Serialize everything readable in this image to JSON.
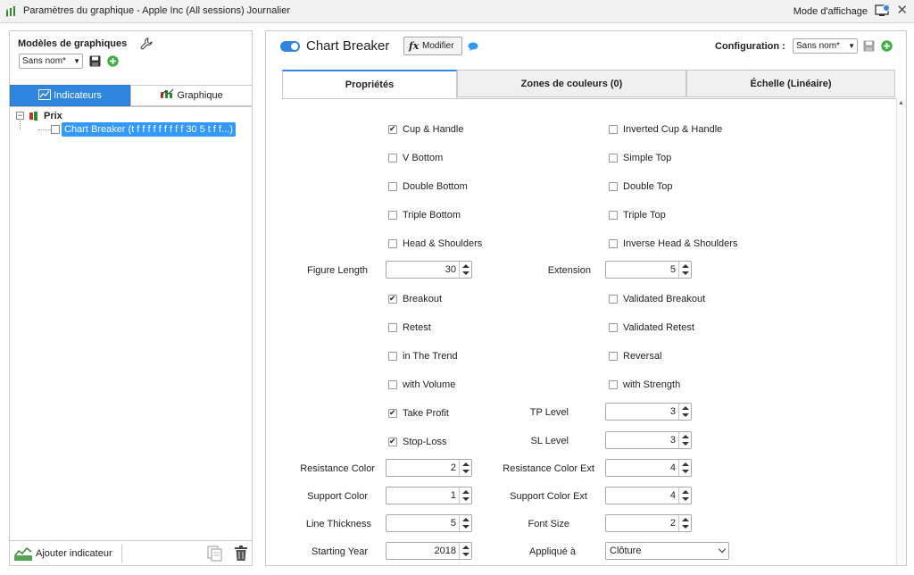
{
  "window": {
    "title": "Paramètres du graphique - Apple Inc (All sessions) Journalier",
    "mode_label": "Mode d'affichage"
  },
  "left": {
    "templates_title": "Modèles de graphiques",
    "template_value": "Sans nom*",
    "tabs": {
      "indicators": "Indicateurs",
      "chart": "Graphique"
    },
    "tree": {
      "root": "Prix",
      "item": "Chart Breaker (t f f f f f f f f f 30 5 t f f...)"
    },
    "add_indicator": "Ajouter indicateur"
  },
  "right": {
    "indicator_name": "Chart Breaker",
    "modify_label": "Modifier",
    "config_label": "Configuration :",
    "config_value": "Sans nom*",
    "tabs": {
      "properties": "Propriétés",
      "color_zones": "Zones de couleurs (0)",
      "scale": "Échelle (Linéaire)"
    }
  },
  "props": {
    "cup_handle": {
      "label": "Cup & Handle",
      "checked": true
    },
    "inv_cup_handle": {
      "label": "Inverted Cup & Handle",
      "checked": false
    },
    "v_bottom": {
      "label": "V Bottom",
      "checked": false
    },
    "simple_top": {
      "label": "Simple Top",
      "checked": false
    },
    "double_bottom": {
      "label": "Double Bottom",
      "checked": false
    },
    "double_top": {
      "label": "Double Top",
      "checked": false
    },
    "triple_bottom": {
      "label": "Triple Bottom",
      "checked": false
    },
    "triple_top": {
      "label": "Triple Top",
      "checked": false
    },
    "head_shoulders": {
      "label": "Head & Shoulders",
      "checked": false
    },
    "inv_head_shoulders": {
      "label": "Inverse Head & Shoulders",
      "checked": false
    },
    "figure_length": {
      "label": "Figure Length",
      "value": "30"
    },
    "extension": {
      "label": "Extension",
      "value": "5"
    },
    "breakout": {
      "label": "Breakout",
      "checked": true
    },
    "validated_breakout": {
      "label": "Validated Breakout",
      "checked": false
    },
    "retest": {
      "label": "Retest",
      "checked": false
    },
    "validated_retest": {
      "label": "Validated Retest",
      "checked": false
    },
    "in_trend": {
      "label": "in The Trend",
      "checked": false
    },
    "reversal": {
      "label": "Reversal",
      "checked": false
    },
    "with_volume": {
      "label": "with Volume",
      "checked": false
    },
    "with_strength": {
      "label": "with Strength",
      "checked": false
    },
    "take_profit": {
      "label": "Take Profit",
      "checked": true
    },
    "tp_level": {
      "label": "TP Level",
      "value": "3"
    },
    "stop_loss": {
      "label": "Stop-Loss",
      "checked": true
    },
    "sl_level": {
      "label": "SL Level",
      "value": "3"
    },
    "resistance_color": {
      "label": "Resistance Color",
      "value": "2"
    },
    "resistance_color_ext": {
      "label": "Resistance Color Ext",
      "value": "4"
    },
    "support_color": {
      "label": "Support Color",
      "value": "1"
    },
    "support_color_ext": {
      "label": "Support Color Ext",
      "value": "4"
    },
    "line_thickness": {
      "label": "Line Thickness",
      "value": "5"
    },
    "font_size": {
      "label": "Font Size",
      "value": "2"
    },
    "starting_year": {
      "label": "Starting Year",
      "value": "2018"
    },
    "applied_to": {
      "label": "Appliqué à",
      "value": "Clôture"
    }
  },
  "colors": {
    "accent": "#2e86de",
    "selection": "#3399ff",
    "add_green": "#3cb043"
  }
}
